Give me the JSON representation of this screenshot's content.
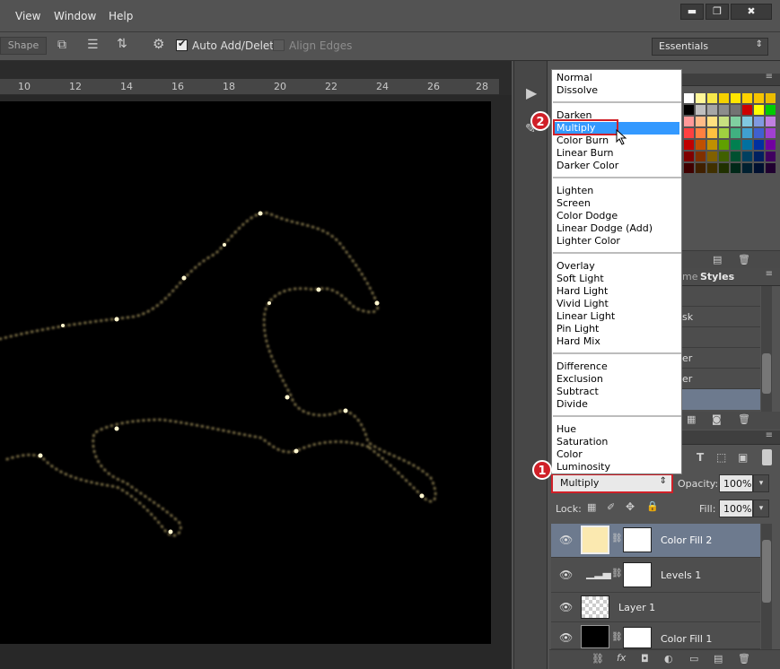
{
  "menubar": {
    "items": [
      "View",
      "Window",
      "Help"
    ],
    "minimize": "▬",
    "restore": "❐",
    "close": "✖"
  },
  "options": {
    "shape_label": "Shape",
    "auto_add_delete": "Auto Add/Delete",
    "align_edges": "Align Edges",
    "workspace": "Essentials"
  },
  "ruler": {
    "ticks": [
      "10",
      "12",
      "14",
      "16",
      "18",
      "20",
      "22",
      "24",
      "26",
      "28"
    ]
  },
  "panels": {
    "tab_styles": "Styles",
    "tab_partial": "me",
    "adj_item_1": "sk",
    "adj_item_2": "er",
    "adj_item_3": "er"
  },
  "blend_menu": {
    "groups": [
      [
        "Normal",
        "Dissolve"
      ],
      [
        "Darken",
        "Multiply",
        "Color Burn",
        "Linear Burn",
        "Darker Color"
      ],
      [
        "Lighten",
        "Screen",
        "Color Dodge",
        "Linear Dodge (Add)",
        "Lighter Color"
      ],
      [
        "Overlay",
        "Soft Light",
        "Hard Light",
        "Vivid Light",
        "Linear Light",
        "Pin Light",
        "Hard Mix"
      ],
      [
        "Difference",
        "Exclusion",
        "Subtract",
        "Divide"
      ],
      [
        "Hue",
        "Saturation",
        "Color",
        "Luminosity"
      ]
    ],
    "selected": "Multiply"
  },
  "layers_panel": {
    "blend_mode": "Multiply",
    "opacity_label": "Opacity:",
    "opacity": "100%",
    "lock_label": "Lock:",
    "fill_label": "Fill:",
    "fill": "100%",
    "layers": [
      {
        "name": "Color Fill 2",
        "selected": true
      },
      {
        "name": "Levels 1",
        "selected": false
      },
      {
        "name": "Layer 1",
        "selected": false
      },
      {
        "name": "Color Fill 1",
        "selected": false
      }
    ]
  },
  "callouts": {
    "one": "1",
    "two": "2"
  },
  "colors": {
    "accent": "#3399ff",
    "callout_red": "#d02028",
    "selected_layer": "#6d7a8e",
    "fill_swatch": "#fbe9b0"
  }
}
